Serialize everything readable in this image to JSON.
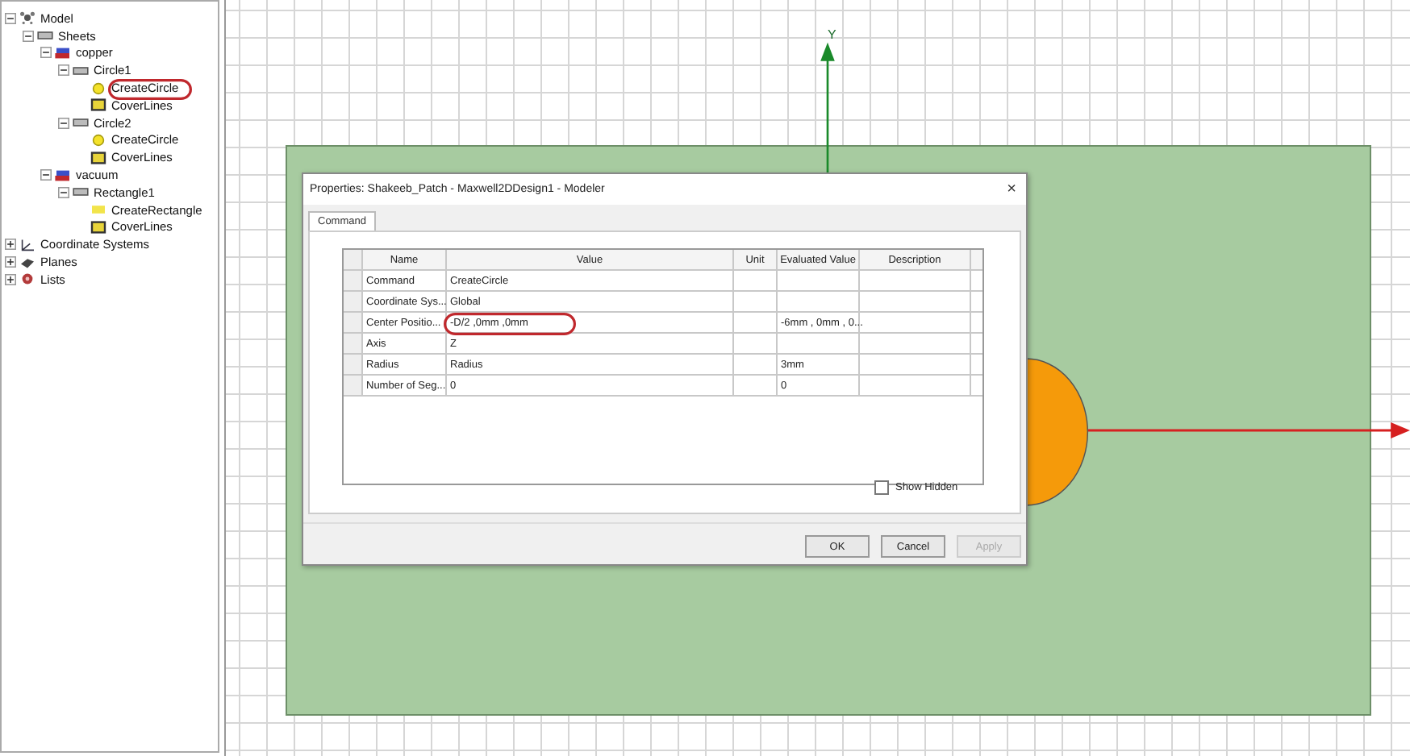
{
  "tree": [
    {
      "label": "Model",
      "kind": "model",
      "expanded": true,
      "children": [
        {
          "label": "Sheets",
          "kind": "sheets",
          "expanded": true,
          "children": [
            {
              "label": "copper",
              "kind": "material",
              "expanded": true,
              "children": [
                {
                  "label": "Circle1",
                  "kind": "object",
                  "expanded": true,
                  "children": [
                    {
                      "label": "CreateCircle",
                      "kind": "circle-op"
                    },
                    {
                      "label": "CoverLines",
                      "kind": "cover"
                    }
                  ]
                },
                {
                  "label": "Circle2",
                  "kind": "object",
                  "expanded": true,
                  "children": [
                    {
                      "label": "CreateCircle",
                      "kind": "circle-op"
                    },
                    {
                      "label": "CoverLines",
                      "kind": "cover"
                    }
                  ]
                }
              ]
            },
            {
              "label": "vacuum",
              "kind": "material",
              "expanded": true,
              "children": [
                {
                  "label": "Rectangle1",
                  "kind": "object",
                  "expanded": true,
                  "children": [
                    {
                      "label": "CreateRectangle",
                      "kind": "rect-op"
                    },
                    {
                      "label": "CoverLines",
                      "kind": "cover"
                    }
                  ]
                }
              ]
            }
          ]
        }
      ]
    },
    {
      "label": "Coordinate Systems",
      "kind": "coords",
      "expanded": false
    },
    {
      "label": "Planes",
      "kind": "planes",
      "expanded": false
    },
    {
      "label": "Lists",
      "kind": "lists",
      "expanded": false
    }
  ],
  "canvas": {
    "y_axis_label": "Y"
  },
  "dialog": {
    "title": "Properties: Shakeeb_Patch - Maxwell2DDesign1 - Modeler",
    "close": "×",
    "tabs": [
      {
        "label": "Command",
        "selected": true
      }
    ],
    "columns": [
      "Name",
      "Value",
      "Unit",
      "Evaluated Value",
      "Description"
    ],
    "rows": [
      {
        "name": "Command",
        "value": "CreateCircle",
        "unit": "",
        "evaluated": ""
      },
      {
        "name": "Coordinate Sys...",
        "value": "Global",
        "unit": "",
        "evaluated": ""
      },
      {
        "name": "Center Positio...",
        "value": "-D/2 ,0mm ,0mm",
        "unit": "",
        "evaluated": "-6mm , 0mm , 0..."
      },
      {
        "name": "Axis",
        "value": "Z",
        "unit": "",
        "evaluated": ""
      },
      {
        "name": "Radius",
        "value": "Radius",
        "unit": "",
        "evaluated": "3mm"
      },
      {
        "name": "Number of Seg...",
        "value": "0",
        "unit": "",
        "evaluated": "0"
      }
    ],
    "show_hidden": {
      "label": "Show Hidden",
      "checked": false
    },
    "buttons": [
      {
        "label": "OK",
        "disabled": false
      },
      {
        "label": "Cancel",
        "disabled": false
      },
      {
        "label": "Apply",
        "disabled": true
      }
    ]
  }
}
